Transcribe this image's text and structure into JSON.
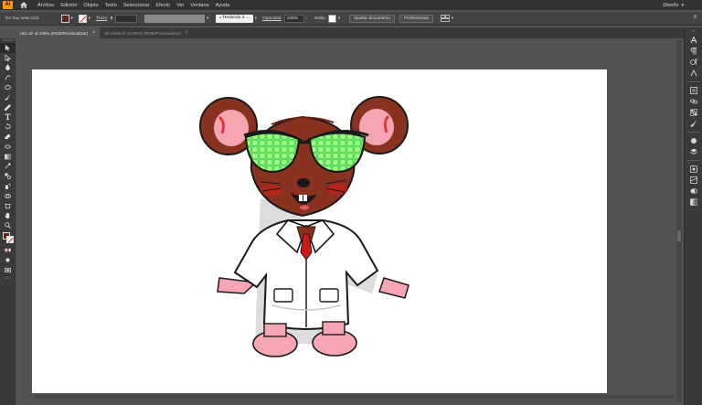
{
  "menu": {
    "app_logo": "Ai",
    "items": [
      "Archivo",
      "Edición",
      "Objeto",
      "Texto",
      "Seleccionar",
      "Efecto",
      "Ver",
      "Ventana",
      "Ayuda"
    ],
    "workspace": "Diseño"
  },
  "control": {
    "selection_status": "No hay selección",
    "stroke_label": "Trazo",
    "brush_preset": "Redondo 3 ...",
    "opacity_label": "Opacidad",
    "opacity_value": "100%",
    "style_label": "Estilo",
    "document_setup": "Ajustar documento",
    "preferences": "Preferencias"
  },
  "tabs": [
    {
      "label": "rat1.ai* al 100% (RGB/Previsualizar)",
      "active": true
    },
    {
      "label": "Sin título-2* al 100% (RGB/Previsualizar)",
      "active": false
    }
  ],
  "colors": {
    "fill": "#5a2a1a",
    "stroke": "#e02020",
    "rat_fur": "#8a3220",
    "lens": "#7dff7d",
    "coat": "#ffffff",
    "ear_inner": "#f6a6b2"
  },
  "tools": [
    "selection-tool",
    "direct-selection-tool",
    "pen-tool",
    "curvature-tool",
    "ellipse-tool",
    "paintbrush-tool",
    "pencil-tool",
    "type-tool",
    "rotate-tool",
    "eraser-tool",
    "width-tool",
    "gradient-tool",
    "eyedropper-tool",
    "blend-tool",
    "symbol-sprayer-tool",
    "shape-builder-tool",
    "artboard-tool",
    "hand-tool",
    "zoom-tool"
  ],
  "right_panels": [
    "character-panel",
    "paragraph-panel",
    "opentype-panel",
    "glyphs-panel",
    "properties-panel",
    "links-panel",
    "swatches-panel",
    "brushes-panel",
    "symbols-panel",
    "layers-panel",
    "appearance-panel",
    "graphic-styles-panel",
    "transparency-panel",
    "color-panel",
    "gradient-panel"
  ]
}
